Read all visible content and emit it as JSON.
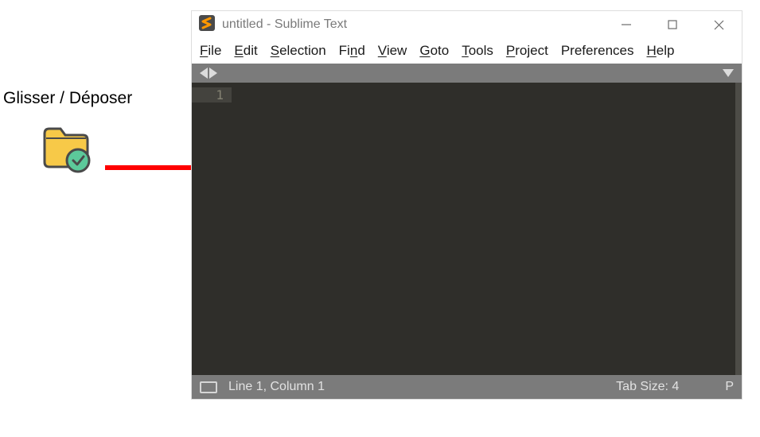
{
  "annotation": {
    "label": "Glisser / Déposer"
  },
  "titlebar": {
    "title": "untitled - Sublime Text"
  },
  "menubar": {
    "items": [
      {
        "key": "F",
        "rest": "ile"
      },
      {
        "key": "E",
        "rest": "dit"
      },
      {
        "key": "S",
        "rest": "election"
      },
      {
        "key": "",
        "rest": "Fi",
        "key2": "n",
        "rest2": "d"
      },
      {
        "key": "V",
        "rest": "iew"
      },
      {
        "key": "G",
        "rest": "oto"
      },
      {
        "key": "T",
        "rest": "ools"
      },
      {
        "key": "P",
        "rest": "roject"
      },
      {
        "key": "",
        "rest": "Preferences"
      },
      {
        "key": "H",
        "rest": "elp"
      }
    ]
  },
  "editor": {
    "line_number": "1"
  },
  "statusbar": {
    "position": "Line 1, Column 1",
    "tab_size": "Tab Size: 4",
    "syntax": "P"
  }
}
